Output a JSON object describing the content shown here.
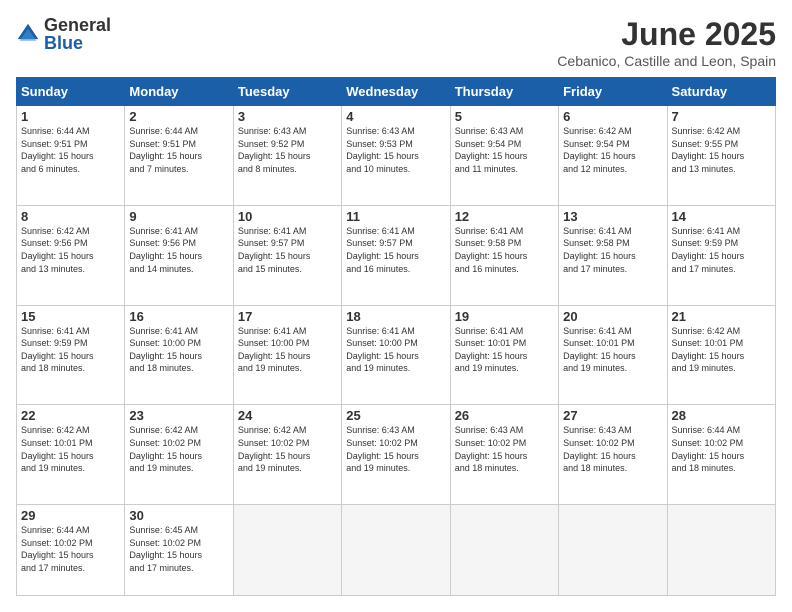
{
  "logo": {
    "general": "General",
    "blue": "Blue"
  },
  "header": {
    "title": "June 2025",
    "location": "Cebanico, Castille and Leon, Spain"
  },
  "weekdays": [
    "Sunday",
    "Monday",
    "Tuesday",
    "Wednesday",
    "Thursday",
    "Friday",
    "Saturday"
  ],
  "weeks": [
    [
      {
        "day": "1",
        "info": "Sunrise: 6:44 AM\nSunset: 9:51 PM\nDaylight: 15 hours\nand 6 minutes."
      },
      {
        "day": "2",
        "info": "Sunrise: 6:44 AM\nSunset: 9:51 PM\nDaylight: 15 hours\nand 7 minutes."
      },
      {
        "day": "3",
        "info": "Sunrise: 6:43 AM\nSunset: 9:52 PM\nDaylight: 15 hours\nand 8 minutes."
      },
      {
        "day": "4",
        "info": "Sunrise: 6:43 AM\nSunset: 9:53 PM\nDaylight: 15 hours\nand 10 minutes."
      },
      {
        "day": "5",
        "info": "Sunrise: 6:43 AM\nSunset: 9:54 PM\nDaylight: 15 hours\nand 11 minutes."
      },
      {
        "day": "6",
        "info": "Sunrise: 6:42 AM\nSunset: 9:54 PM\nDaylight: 15 hours\nand 12 minutes."
      },
      {
        "day": "7",
        "info": "Sunrise: 6:42 AM\nSunset: 9:55 PM\nDaylight: 15 hours\nand 13 minutes."
      }
    ],
    [
      {
        "day": "8",
        "info": "Sunrise: 6:42 AM\nSunset: 9:56 PM\nDaylight: 15 hours\nand 13 minutes."
      },
      {
        "day": "9",
        "info": "Sunrise: 6:41 AM\nSunset: 9:56 PM\nDaylight: 15 hours\nand 14 minutes."
      },
      {
        "day": "10",
        "info": "Sunrise: 6:41 AM\nSunset: 9:57 PM\nDaylight: 15 hours\nand 15 minutes."
      },
      {
        "day": "11",
        "info": "Sunrise: 6:41 AM\nSunset: 9:57 PM\nDaylight: 15 hours\nand 16 minutes."
      },
      {
        "day": "12",
        "info": "Sunrise: 6:41 AM\nSunset: 9:58 PM\nDaylight: 15 hours\nand 16 minutes."
      },
      {
        "day": "13",
        "info": "Sunrise: 6:41 AM\nSunset: 9:58 PM\nDaylight: 15 hours\nand 17 minutes."
      },
      {
        "day": "14",
        "info": "Sunrise: 6:41 AM\nSunset: 9:59 PM\nDaylight: 15 hours\nand 17 minutes."
      }
    ],
    [
      {
        "day": "15",
        "info": "Sunrise: 6:41 AM\nSunset: 9:59 PM\nDaylight: 15 hours\nand 18 minutes."
      },
      {
        "day": "16",
        "info": "Sunrise: 6:41 AM\nSunset: 10:00 PM\nDaylight: 15 hours\nand 18 minutes."
      },
      {
        "day": "17",
        "info": "Sunrise: 6:41 AM\nSunset: 10:00 PM\nDaylight: 15 hours\nand 19 minutes."
      },
      {
        "day": "18",
        "info": "Sunrise: 6:41 AM\nSunset: 10:00 PM\nDaylight: 15 hours\nand 19 minutes."
      },
      {
        "day": "19",
        "info": "Sunrise: 6:41 AM\nSunset: 10:01 PM\nDaylight: 15 hours\nand 19 minutes."
      },
      {
        "day": "20",
        "info": "Sunrise: 6:41 AM\nSunset: 10:01 PM\nDaylight: 15 hours\nand 19 minutes."
      },
      {
        "day": "21",
        "info": "Sunrise: 6:42 AM\nSunset: 10:01 PM\nDaylight: 15 hours\nand 19 minutes."
      }
    ],
    [
      {
        "day": "22",
        "info": "Sunrise: 6:42 AM\nSunset: 10:01 PM\nDaylight: 15 hours\nand 19 minutes."
      },
      {
        "day": "23",
        "info": "Sunrise: 6:42 AM\nSunset: 10:02 PM\nDaylight: 15 hours\nand 19 minutes."
      },
      {
        "day": "24",
        "info": "Sunrise: 6:42 AM\nSunset: 10:02 PM\nDaylight: 15 hours\nand 19 minutes."
      },
      {
        "day": "25",
        "info": "Sunrise: 6:43 AM\nSunset: 10:02 PM\nDaylight: 15 hours\nand 19 minutes."
      },
      {
        "day": "26",
        "info": "Sunrise: 6:43 AM\nSunset: 10:02 PM\nDaylight: 15 hours\nand 18 minutes."
      },
      {
        "day": "27",
        "info": "Sunrise: 6:43 AM\nSunset: 10:02 PM\nDaylight: 15 hours\nand 18 minutes."
      },
      {
        "day": "28",
        "info": "Sunrise: 6:44 AM\nSunset: 10:02 PM\nDaylight: 15 hours\nand 18 minutes."
      }
    ],
    [
      {
        "day": "29",
        "info": "Sunrise: 6:44 AM\nSunset: 10:02 PM\nDaylight: 15 hours\nand 17 minutes."
      },
      {
        "day": "30",
        "info": "Sunrise: 6:45 AM\nSunset: 10:02 PM\nDaylight: 15 hours\nand 17 minutes."
      },
      {
        "day": "",
        "info": ""
      },
      {
        "day": "",
        "info": ""
      },
      {
        "day": "",
        "info": ""
      },
      {
        "day": "",
        "info": ""
      },
      {
        "day": "",
        "info": ""
      }
    ]
  ]
}
